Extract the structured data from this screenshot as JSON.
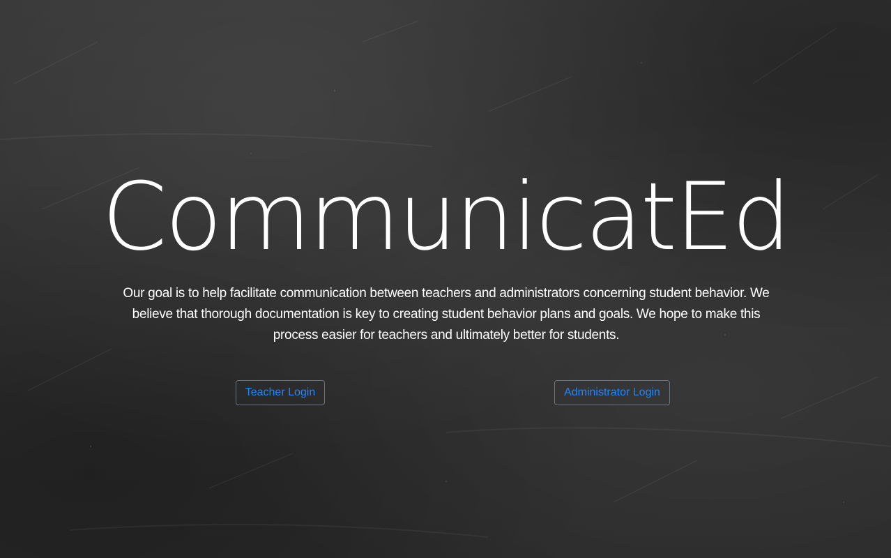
{
  "page": {
    "title": "CommunicatEd",
    "mission": "Our goal is to help facilitate communication between teachers and administrators concerning student behavior. We believe that thorough documentation is key to creating student behavior plans and goals. We hope to make this process easier for teachers and ultimately better for students."
  },
  "buttons": {
    "teacher_login": "Teacher Login",
    "admin_login": "Administrator Login"
  },
  "colors": {
    "background": "#2e2e2e",
    "text": "#ffffff",
    "link": "#1f86ff",
    "button_border": "#6c757d"
  }
}
